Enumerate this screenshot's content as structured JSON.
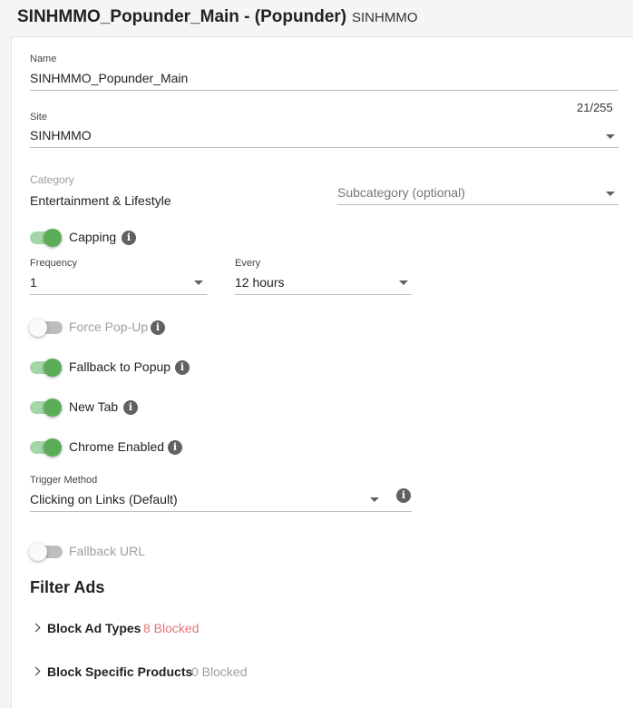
{
  "header": {
    "title": "SINHMMO_Popunder_Main - (Popunder)",
    "site": "SINHMMO"
  },
  "form": {
    "name": {
      "label": "Name",
      "value": "SINHMMO_Popunder_Main",
      "counter": "21/255"
    },
    "site": {
      "label": "Site",
      "value": "SINHMMO"
    },
    "category": {
      "label": "Category",
      "value": "Entertainment & Lifestyle"
    },
    "subcategory": {
      "placeholder": "Subcategory (optional)"
    },
    "capping": {
      "label": "Capping",
      "on": true
    },
    "frequency": {
      "label": "Frequency",
      "value": "1"
    },
    "every": {
      "label": "Every",
      "value": "12 hours"
    },
    "force_popup": {
      "label": "Force Pop-Up",
      "on": false
    },
    "fallback_popup": {
      "label": "Fallback to Popup",
      "on": true
    },
    "new_tab": {
      "label": "New Tab",
      "on": true
    },
    "chrome_enabled": {
      "label": "Chrome Enabled",
      "on": true
    },
    "trigger_method": {
      "label": "Trigger Method",
      "value": "Clicking on Links (Default)"
    },
    "fallback_url": {
      "label": "Fallback URL",
      "on": false
    }
  },
  "filter_ads": {
    "title": "Filter Ads",
    "block_ad_types": {
      "label": "Block Ad Types",
      "count": "8 Blocked"
    },
    "block_specific_products": {
      "label": "Block Specific Products",
      "count": "0 Blocked"
    }
  },
  "colors": {
    "toggle_on": "#5aad56",
    "toggle_track_on": "#a5d6a7",
    "blocked_count": "#e57373"
  },
  "icons": {
    "info": "info-icon",
    "dropdown": "caret-down-icon",
    "expand": "chevron-right-icon"
  }
}
